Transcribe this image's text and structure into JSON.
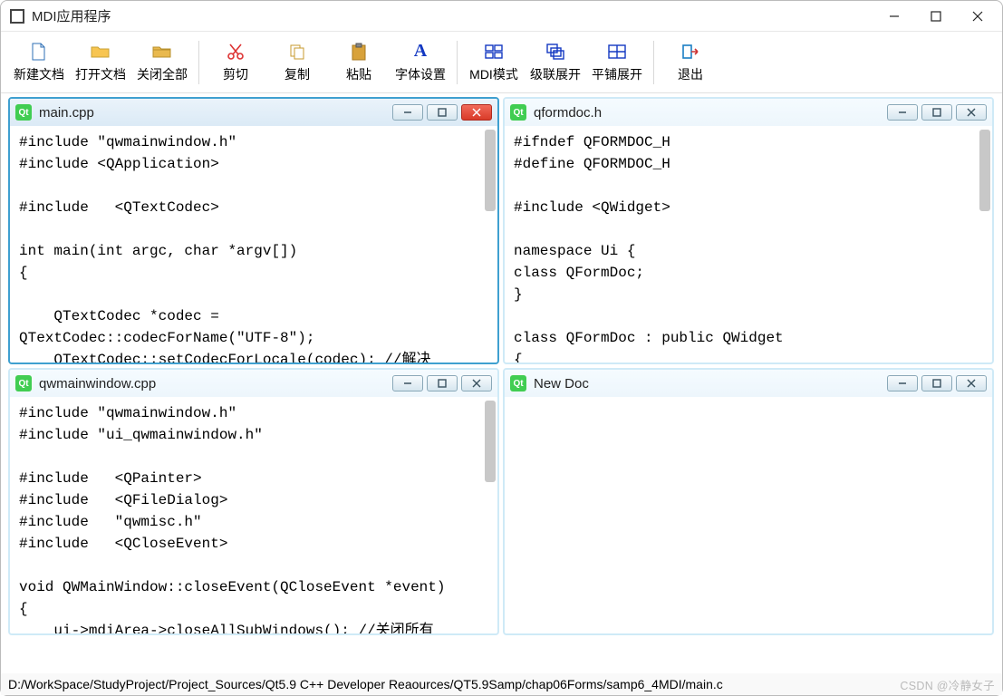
{
  "window": {
    "title": "MDI应用程序"
  },
  "toolbar": {
    "new_doc": "新建文档",
    "open_doc": "打开文档",
    "close_all": "关闭全部",
    "cut": "剪切",
    "copy": "复制",
    "paste": "粘贴",
    "font_settings": "字体设置",
    "mdi_mode": "MDI模式",
    "cascade": "级联展开",
    "tile": "平铺展开",
    "exit": "退出"
  },
  "mdi": {
    "win1": {
      "title": "main.cpp",
      "code": "#include \"qwmainwindow.h\"\n#include <QApplication>\n\n#include   <QTextCodec>\n\nint main(int argc, char *argv[])\n{\n\n    QTextCodec *codec =\nQTextCodec::codecForName(\"UTF-8\");\n    QTextCodec::setCodecForLocale(codec); //解决"
    },
    "win2": {
      "title": "qformdoc.h",
      "code": "#ifndef QFORMDOC_H\n#define QFORMDOC_H\n\n#include <QWidget>\n\nnamespace Ui {\nclass QFormDoc;\n}\n\nclass QFormDoc : public QWidget\n{"
    },
    "win3": {
      "title": "qwmainwindow.cpp",
      "code": "#include \"qwmainwindow.h\"\n#include \"ui_qwmainwindow.h\"\n\n#include   <QPainter>\n#include   <QFileDialog>\n#include   \"qwmisc.h\"\n#include   <QCloseEvent>\n\nvoid QWMainWindow::closeEvent(QCloseEvent *event)\n{\n    ui->mdiArea->closeAllSubWindows(); //关闭所有"
    },
    "win4": {
      "title": "New Doc",
      "code": ""
    }
  },
  "statusbar": {
    "path": "D:/WorkSpace/StudyProject/Project_Sources/Qt5.9 C++ Developer Reaources/QT5.9Samp/chap06Forms/samp6_4MDI/main.c",
    "watermark": "CSDN @冷静女子"
  },
  "colors": {
    "accent": "#3fa0d0",
    "qt_green": "#41cd52",
    "close_red": "#d93b28"
  }
}
